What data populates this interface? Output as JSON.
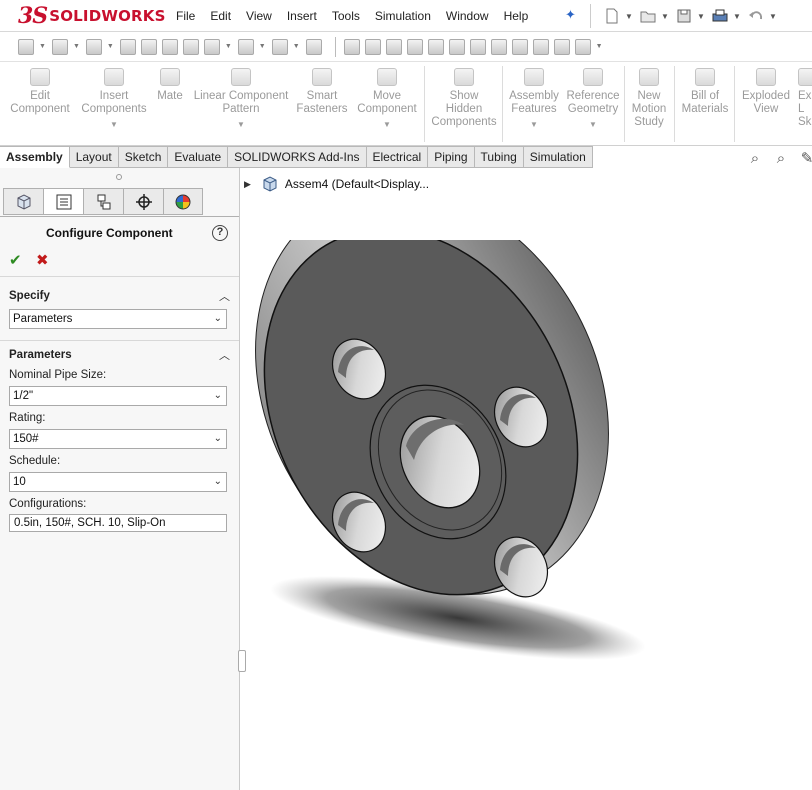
{
  "app": {
    "brand": "SOLIDWORKS",
    "brand_prefix": "3S"
  },
  "menu": [
    "File",
    "Edit",
    "View",
    "Insert",
    "Tools",
    "Simulation",
    "Window",
    "Help"
  ],
  "commands": [
    {
      "label": "Edit\nComponent"
    },
    {
      "label": "Insert\nComponents"
    },
    {
      "label": "Mate"
    },
    {
      "label": "Linear Component\nPattern"
    },
    {
      "label": "Smart\nFasteners"
    },
    {
      "label": "Move\nComponent"
    },
    {
      "label": "Show\nHidden\nComponents"
    },
    {
      "label": "Assembly\nFeatures"
    },
    {
      "label": "Reference\nGeometry"
    },
    {
      "label": "New\nMotion\nStudy"
    },
    {
      "label": "Bill of\nMaterials"
    },
    {
      "label": "Exploded\nView"
    },
    {
      "label": "Ex\nL\nSk"
    }
  ],
  "tabs": [
    "Assembly",
    "Layout",
    "Sketch",
    "Evaluate",
    "SOLIDWORKS Add-Ins",
    "Electrical",
    "Piping",
    "Tubing",
    "Simulation"
  ],
  "active_tab": "Assembly",
  "tree": {
    "root": "Assem4  (Default<Display..."
  },
  "panel": {
    "title": "Configure Component",
    "help": "?",
    "specify": {
      "heading": "Specify",
      "value": "Parameters"
    },
    "parameters": {
      "heading": "Parameters",
      "nominal_label": "Nominal Pipe Size:",
      "nominal_value": "1/2\"",
      "rating_label": "Rating:",
      "rating_value": "150#",
      "schedule_label": "Schedule:",
      "schedule_value": "10",
      "config_label": "Configurations:",
      "config_value": "0.5in, 150#, SCH. 10, Slip-On"
    }
  },
  "colors": {
    "brand": "#c8102e",
    "ok": "#2e8b22",
    "cancel": "#c21b1b",
    "flange": "#5a5a5a"
  }
}
